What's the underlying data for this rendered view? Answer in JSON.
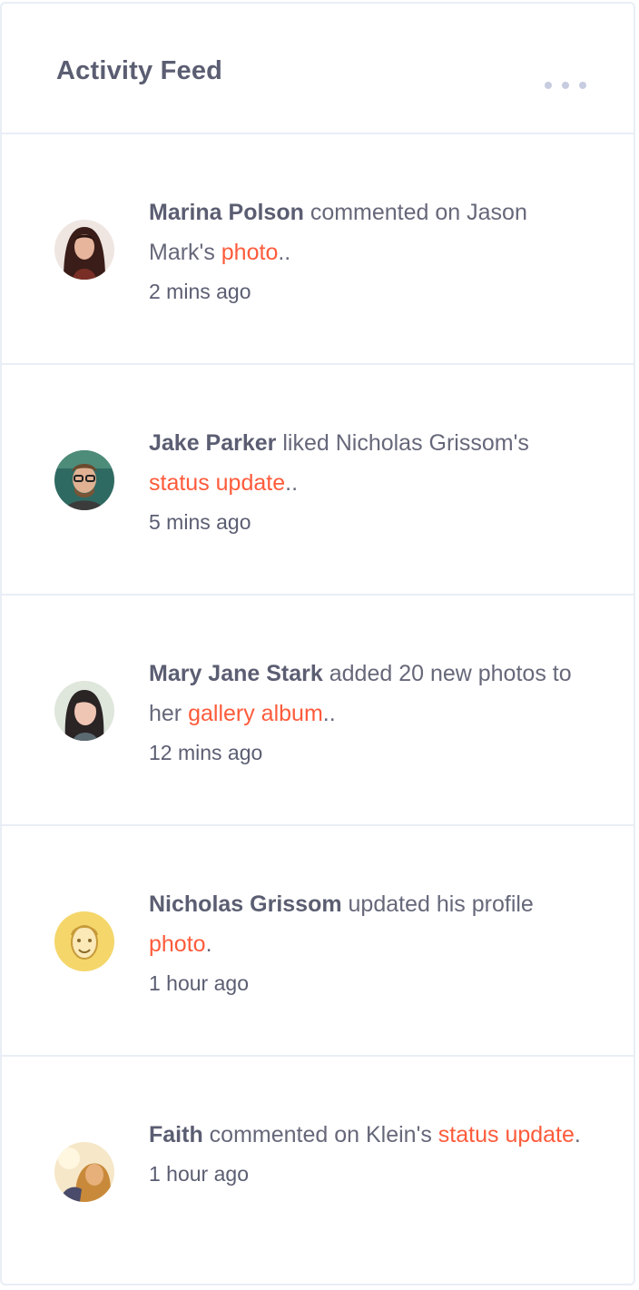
{
  "header": {
    "title": "Activity Feed",
    "menu_icon": "ellipsis-horizontal-icon"
  },
  "colors": {
    "link": "#fe5b3b",
    "text": "#66687a",
    "heading": "#5b5e72",
    "divider": "#e9eef6"
  },
  "feed": [
    {
      "name": "Marina Polson",
      "action": " commented on Jason Mark's ",
      "link": "photo",
      "suffix": "..",
      "time": "2 mins ago",
      "avatar": "avatar-marina"
    },
    {
      "name": "Jake Parker",
      "action": " liked Nicholas Grissom's ",
      "link": "status update",
      "suffix": "..",
      "time": "5 mins ago",
      "avatar": "avatar-jake"
    },
    {
      "name": "Mary Jane Stark",
      "action": " added 20 new photos to her ",
      "link": "gallery album",
      "suffix": "..",
      "time": "12 mins ago",
      "avatar": "avatar-mary"
    },
    {
      "name": "Nicholas Grissom",
      "action": " updated his profile ",
      "link": "photo",
      "suffix": ".",
      "time": "1 hour ago",
      "avatar": "avatar-nicholas"
    },
    {
      "name": "Faith",
      "action": " commented on Klein's ",
      "link": "status update",
      "suffix": ".",
      "time": "1 hour ago",
      "avatar": "avatar-faith"
    }
  ]
}
